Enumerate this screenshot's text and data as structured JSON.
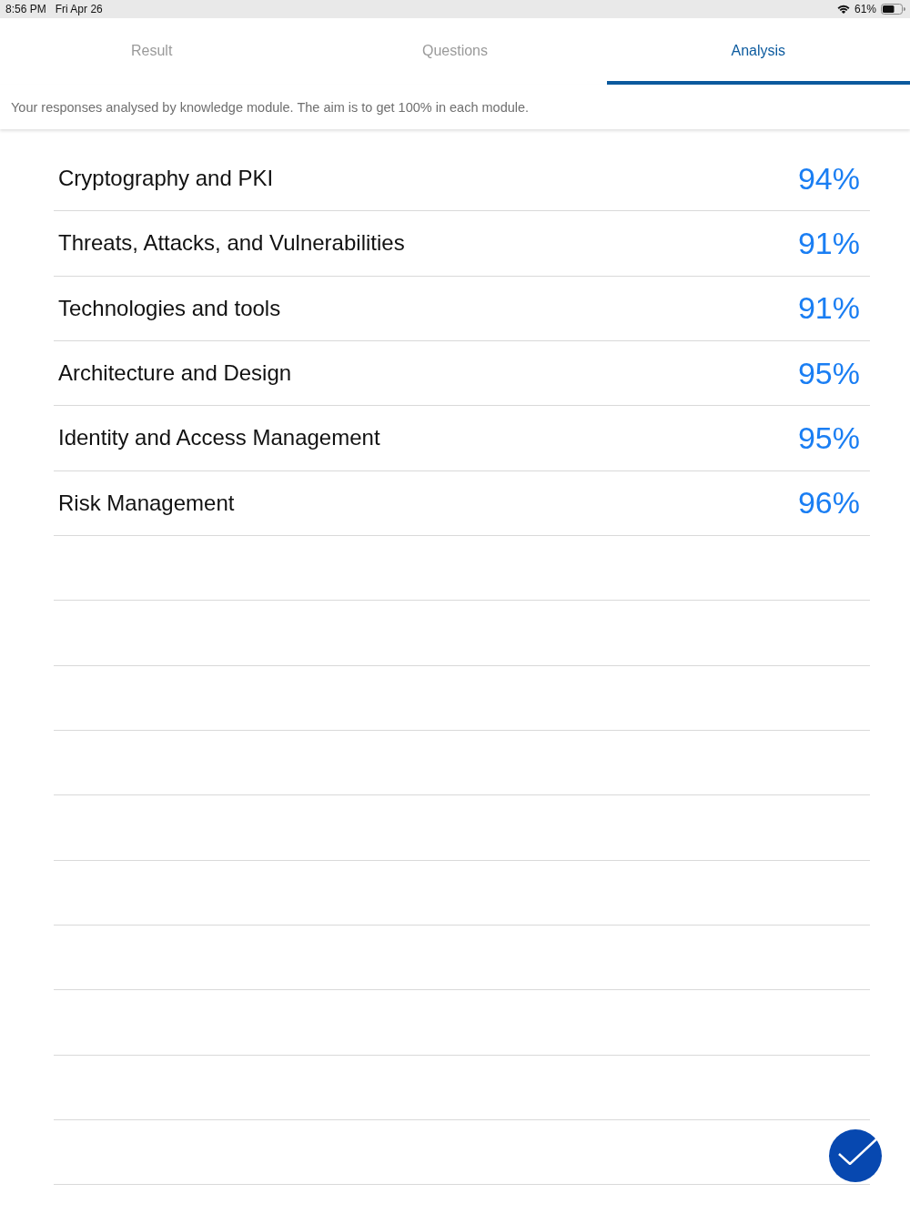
{
  "status_bar": {
    "time": "8:56 PM",
    "date": "Fri Apr 26",
    "battery_text": "61%"
  },
  "tabs": [
    {
      "label": "Result",
      "selected": false
    },
    {
      "label": "Questions",
      "selected": false
    },
    {
      "label": "Analysis",
      "selected": true
    }
  ],
  "info_text": "Your responses analysed by knowledge module. The aim is to get 100% in each module.",
  "modules": [
    {
      "name": "Cryptography and PKI",
      "score": "94%"
    },
    {
      "name": "Threats, Attacks, and Vulnerabilities",
      "score": "91%"
    },
    {
      "name": "Technologies and tools",
      "score": "91%"
    },
    {
      "name": "Architecture and Design",
      "score": "95%"
    },
    {
      "name": "Identity and Access Management",
      "score": "95%"
    },
    {
      "name": "Risk Management",
      "score": "96%"
    }
  ]
}
